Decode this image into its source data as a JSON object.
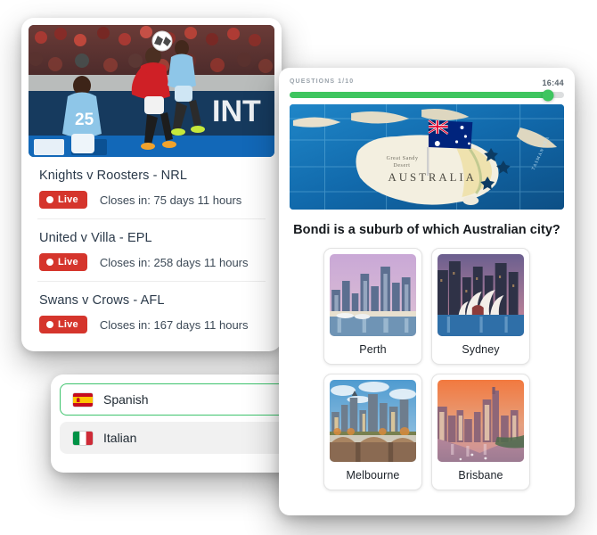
{
  "sports": {
    "photo_alt": "football-header-photo",
    "matches": [
      {
        "title": "Knights v Roosters - NRL",
        "status": "Live",
        "closes": "Closes in: 75 days 11 hours"
      },
      {
        "title": "United v Villa - EPL",
        "status": "Live",
        "closes": "Closes in: 258 days 11 hours"
      },
      {
        "title": "Swans v Crows - AFL",
        "status": "Live",
        "closes": "Closes in: 167 days 11 hours"
      }
    ],
    "live_color": "#d5352c"
  },
  "language": {
    "options": [
      {
        "label": "Spanish",
        "flag": "spain-flag",
        "selected": true
      },
      {
        "label": "Italian",
        "flag": "italy-flag",
        "selected": false
      }
    ],
    "selected_border_color": "#3ec46d"
  },
  "quiz": {
    "counter": "QUESTIONS 1/10",
    "timer": "16:44",
    "progress_percent": 94,
    "progress_color": "#3ec55f",
    "map_alt": "australia-map-photo",
    "question": "Bondi is a suburb of which Australian city?",
    "answers": [
      {
        "label": "Perth",
        "photo": "perth-skyline-photo"
      },
      {
        "label": "Sydney",
        "photo": "sydney-opera-house-photo"
      },
      {
        "label": "Melbourne",
        "photo": "melbourne-bridge-photo"
      },
      {
        "label": "Brisbane",
        "photo": "brisbane-river-photo"
      }
    ]
  }
}
